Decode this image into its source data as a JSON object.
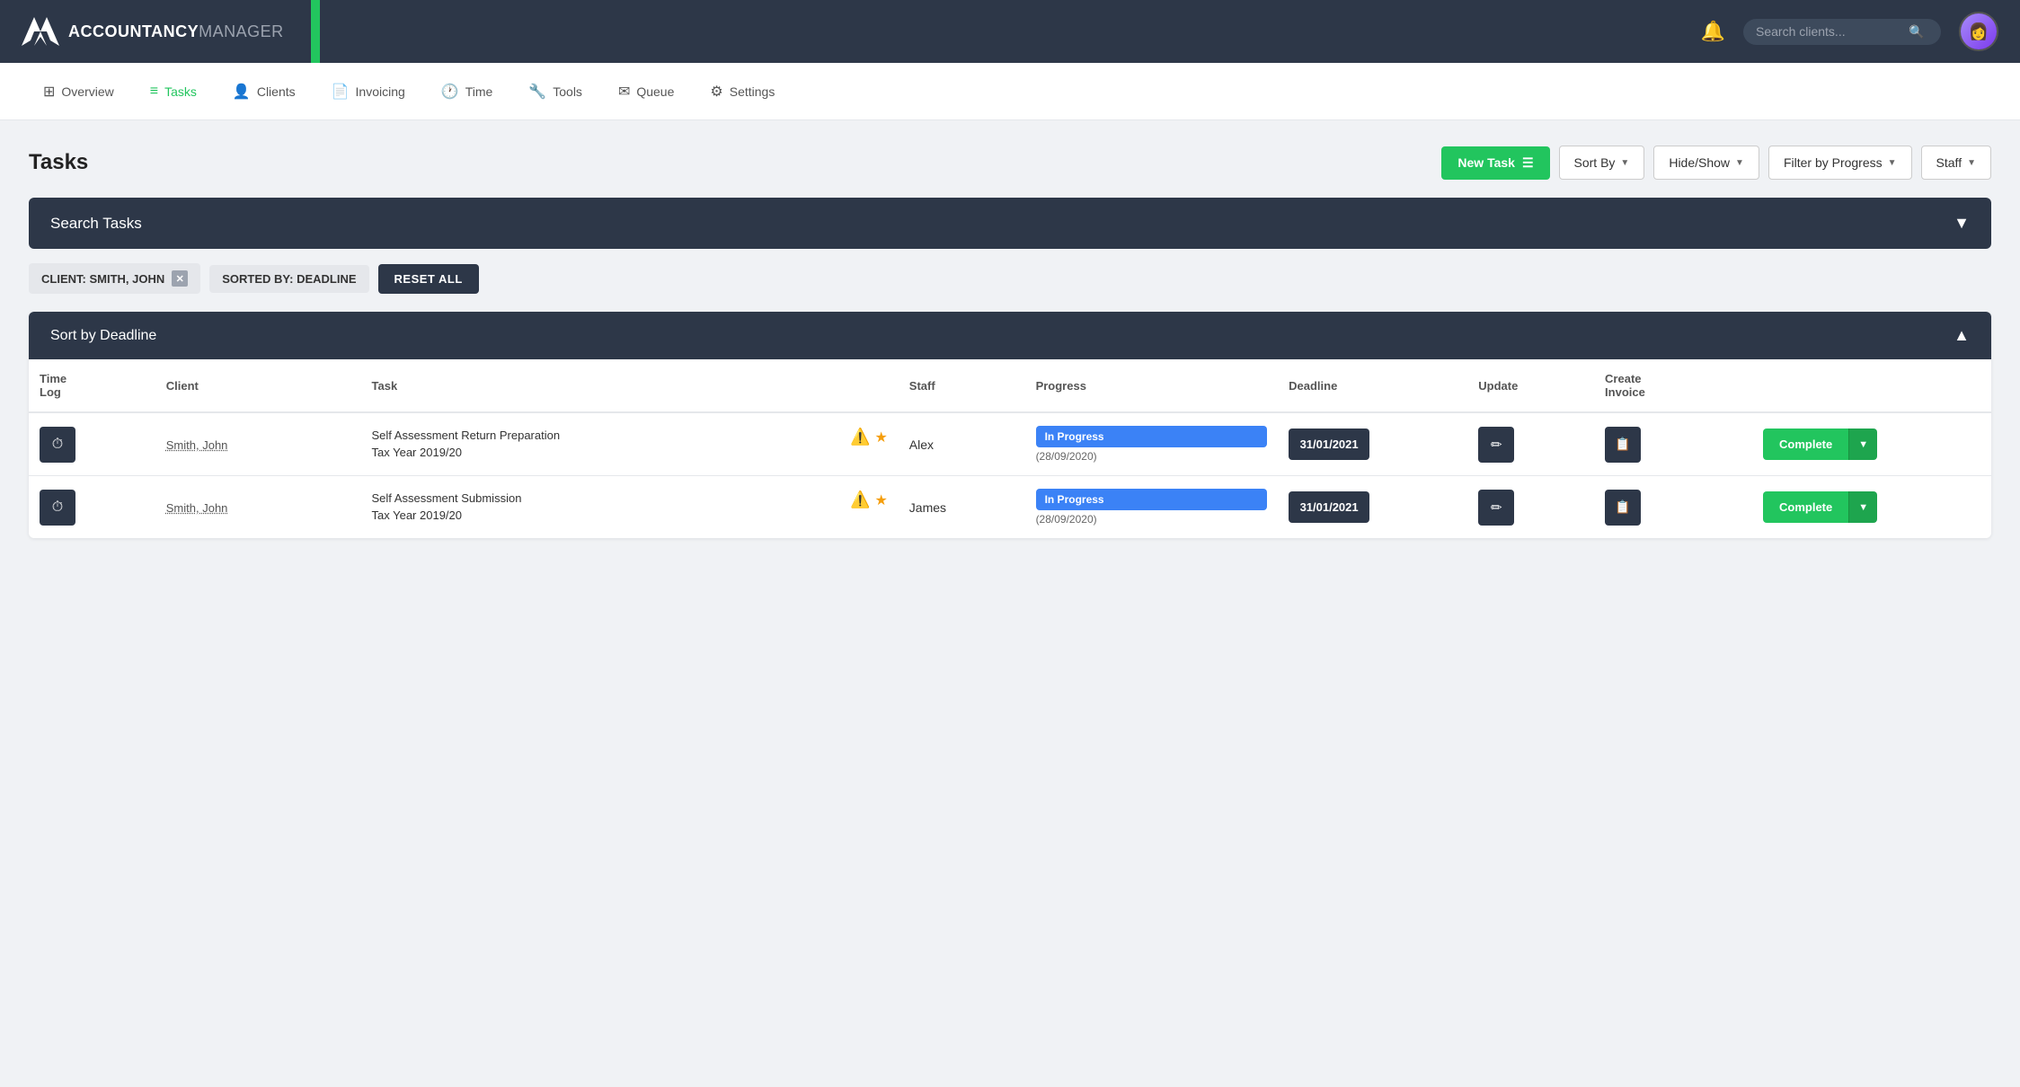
{
  "topNav": {
    "logoText1": "ACCOUNTANCY",
    "logoText2": "MANAGER",
    "searchPlaceholder": "Search clients...",
    "bellLabel": "Notifications"
  },
  "secNav": {
    "items": [
      {
        "id": "overview",
        "label": "Overview",
        "icon": "⊞",
        "active": false
      },
      {
        "id": "tasks",
        "label": "Tasks",
        "icon": "≡",
        "active": true
      },
      {
        "id": "clients",
        "label": "Clients",
        "icon": "👤",
        "active": false
      },
      {
        "id": "invoicing",
        "label": "Invoicing",
        "icon": "📄",
        "active": false
      },
      {
        "id": "time",
        "label": "Time",
        "icon": "🕐",
        "active": false
      },
      {
        "id": "tools",
        "label": "Tools",
        "icon": "🔧",
        "active": false
      },
      {
        "id": "queue",
        "label": "Queue",
        "icon": "✉",
        "active": false
      },
      {
        "id": "settings",
        "label": "Settings",
        "icon": "⚙",
        "active": false
      }
    ]
  },
  "pageHeader": {
    "title": "Tasks",
    "newTaskLabel": "New Task",
    "sortByLabel": "Sort By",
    "hideShowLabel": "Hide/Show",
    "filterProgressLabel": "Filter by Progress",
    "staffLabel": "Staff"
  },
  "searchTasks": {
    "label": "Search Tasks",
    "chevron": "▼"
  },
  "filters": {
    "clientLabel": "CLIENT:",
    "clientValue": "SMITH, JOHN",
    "sortedLabel": "SORTED BY: DEADLINE",
    "resetAll": "RESET ALL"
  },
  "sortSection": {
    "label": "Sort by Deadline",
    "chevron": "▲"
  },
  "tableHeaders": {
    "timeLog": "Time\nLog",
    "client": "Client",
    "task": "Task",
    "staff": "Staff",
    "progress": "Progress",
    "deadline": "Deadline",
    "update": "Update",
    "createInvoice": "Create\nInvoice",
    "action": ""
  },
  "rows": [
    {
      "id": 1,
      "client": "Smith, John",
      "taskName": "Self Assessment Return Preparation",
      "taskSub": "Tax Year 2019/20",
      "hasAlert": true,
      "hasStar": true,
      "staff": "Alex",
      "progressLabel": "In Progress",
      "progressDate": "(28/09/2020)",
      "deadline": "31/01/2021",
      "completeLabel": "Complete"
    },
    {
      "id": 2,
      "client": "Smith, John",
      "taskName": "Self Assessment Submission",
      "taskSub": "Tax Year 2019/20",
      "hasAlert": true,
      "hasStar": true,
      "staff": "James",
      "progressLabel": "In Progress",
      "progressDate": "(28/09/2020)",
      "deadline": "31/01/2021",
      "completeLabel": "Complete"
    }
  ]
}
